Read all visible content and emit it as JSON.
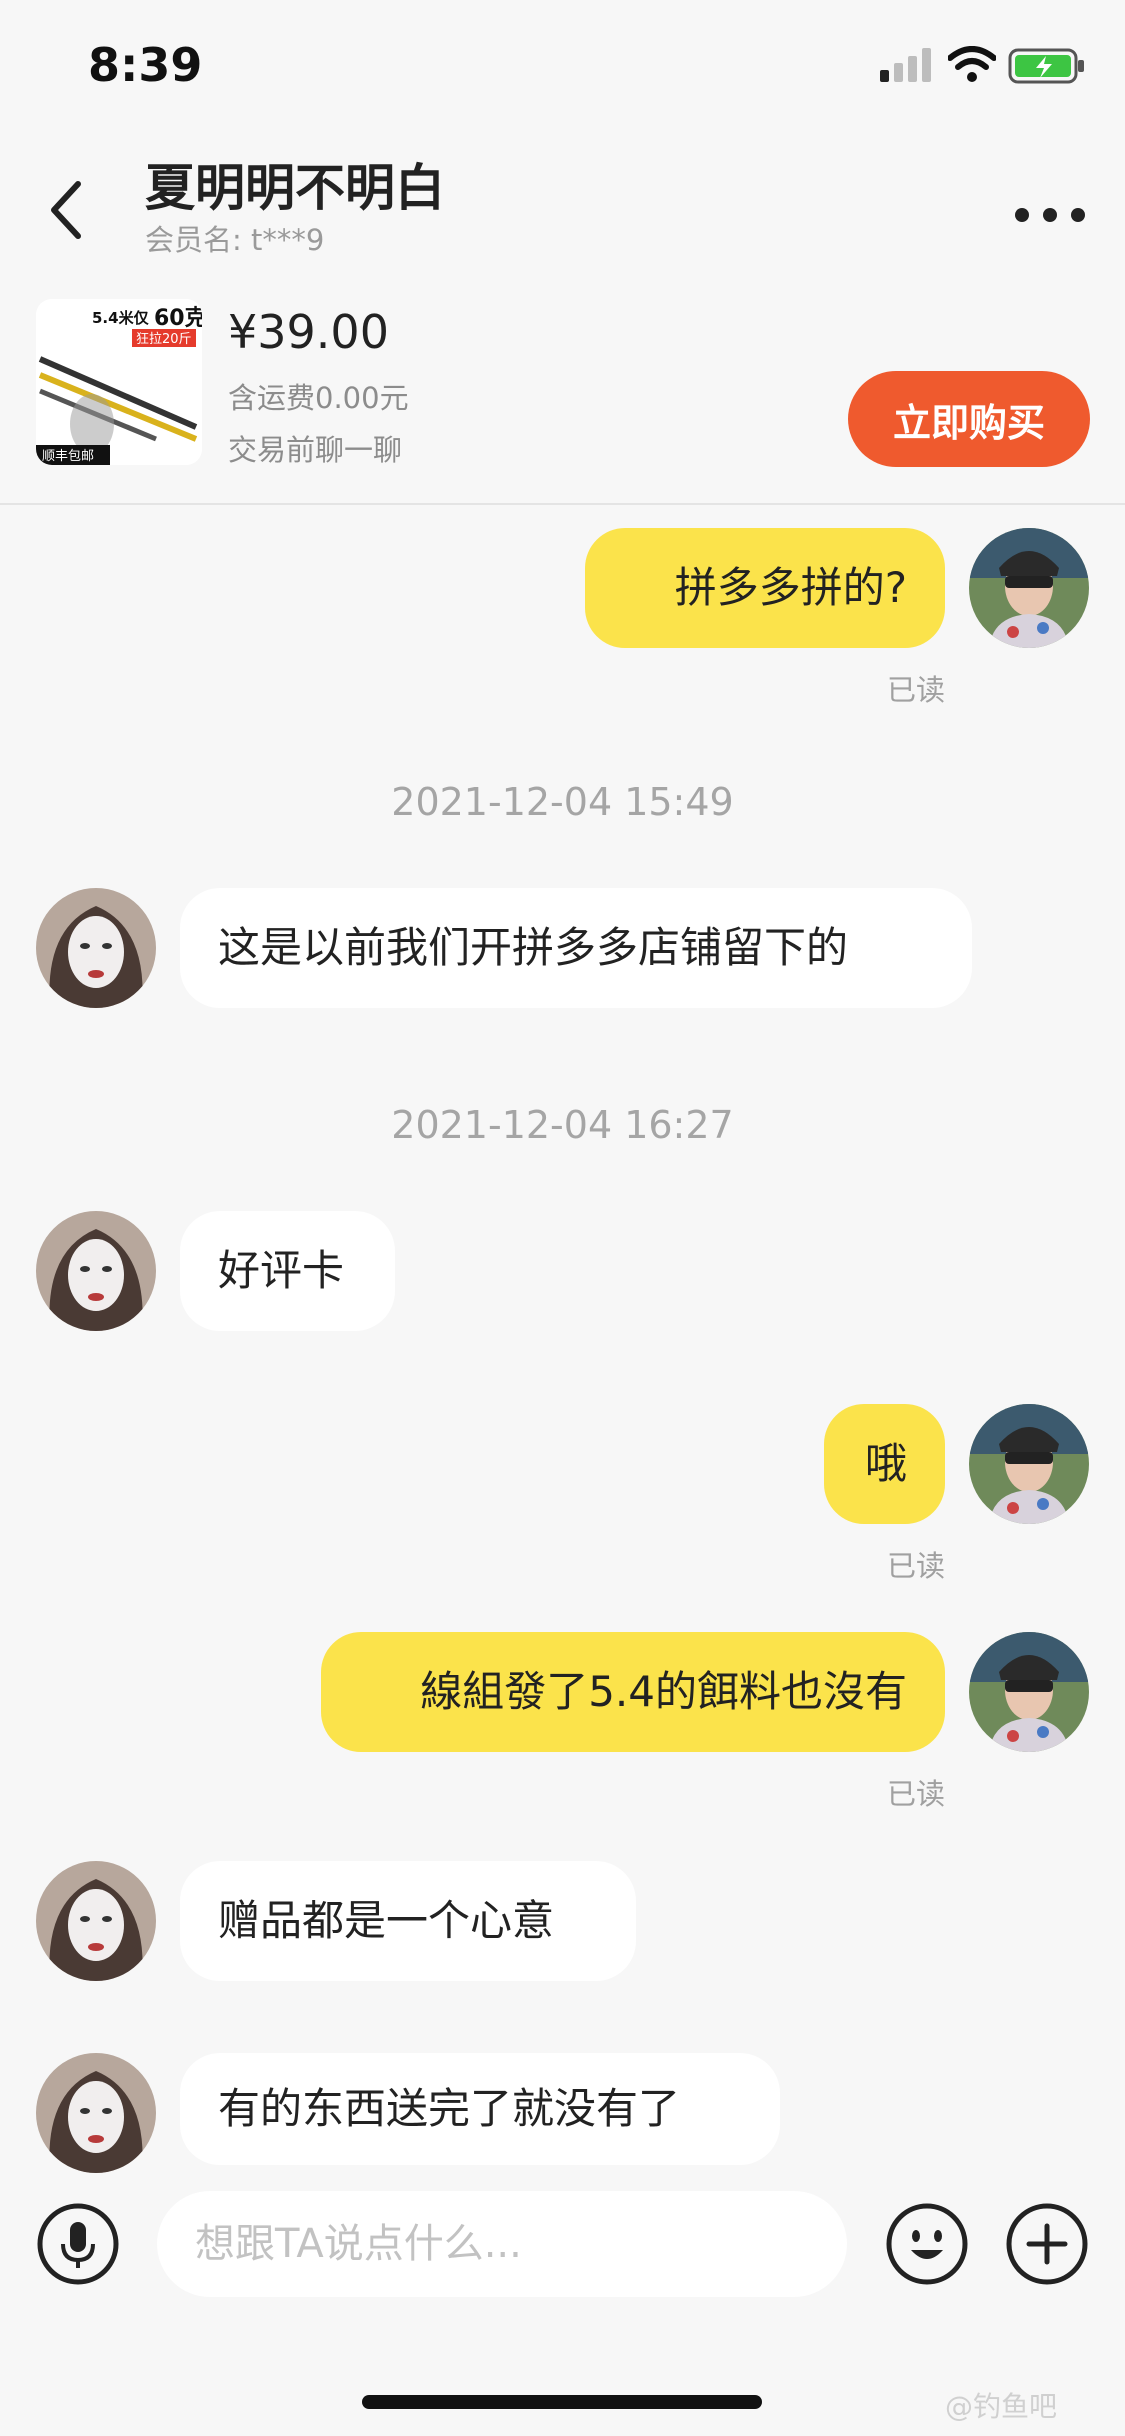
{
  "status_bar": {
    "time": "8:39"
  },
  "header": {
    "title": "夏明明不明白",
    "member_label": "会员名: t***9"
  },
  "product": {
    "thumbnail": {
      "promo_text": "5.4米仅",
      "promo_weight": "60克",
      "tag": "狂拉20斤",
      "badge": "顺丰包邮"
    },
    "price": "¥39.00",
    "shipping": "含运费0.00元",
    "note": "交易前聊一聊",
    "buy_label": "立即购买"
  },
  "messages": [
    {
      "side": "me",
      "text": "拼多多拼的?",
      "read": "已读"
    },
    {
      "timestamp": "2021-12-04 15:49"
    },
    {
      "side": "them",
      "text": "这是以前我们开拼多多店铺留下的"
    },
    {
      "timestamp": "2021-12-04 16:27"
    },
    {
      "side": "them",
      "text": "好评卡"
    },
    {
      "side": "me",
      "text": "哦",
      "read": "已读"
    },
    {
      "side": "me",
      "text": "線組發了5.4的餌料也沒有",
      "read": "已读"
    },
    {
      "side": "them",
      "text": "赠品都是一个心意"
    },
    {
      "side": "them",
      "text": "有的东西送完了就没有了"
    }
  ],
  "input": {
    "placeholder": "想跟TA说点什么..."
  },
  "watermark": "@钓鱼吧",
  "colors": {
    "my_bubble": "#fbe34b",
    "their_bubble": "#ffffff",
    "buy_button": "#ef5a2e",
    "background": "#f7f7f7"
  },
  "icons": [
    "back-icon",
    "more-icon",
    "mic-icon",
    "emoji-icon",
    "plus-icon",
    "signal-icon",
    "wifi-icon",
    "battery-icon"
  ]
}
